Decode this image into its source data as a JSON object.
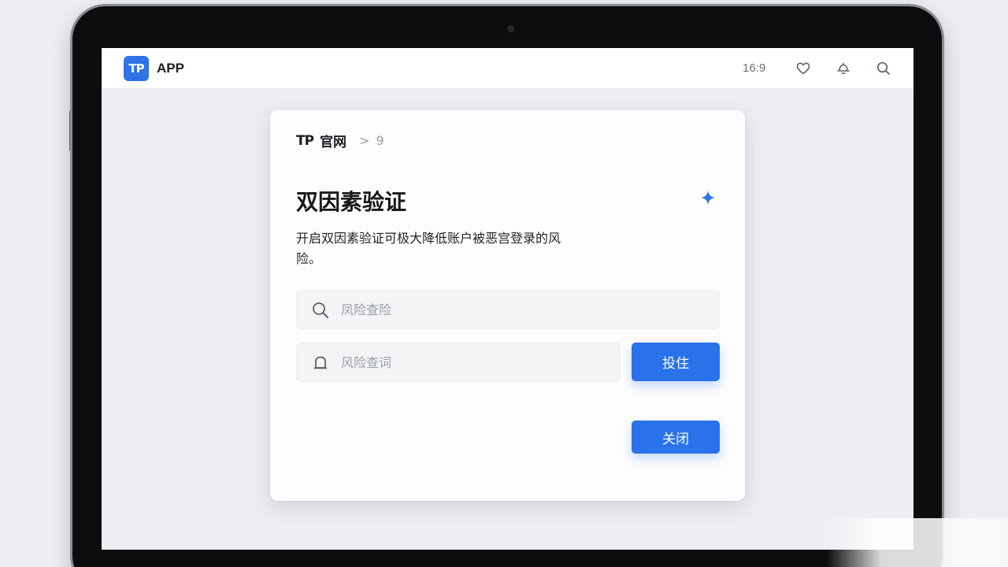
{
  "app": {
    "logo_text": "TP",
    "name": "APP"
  },
  "topbar": {
    "ratio_text": "16:9",
    "icons": [
      "heart-icon",
      "bell-icon",
      "search-icon"
    ]
  },
  "breadcrumb": {
    "logo_text": "TP",
    "site": "官网",
    "separator": ">",
    "page": "9"
  },
  "dialog": {
    "title": "双因素验证",
    "description": "开启双因素验证可极大降低账户被恶宫登录的风险。",
    "field_1": {
      "icon": "search-icon",
      "placeholder": "凤险查险",
      "value": ""
    },
    "field_2": {
      "icon": "bell-icon",
      "placeholder": "风险查词",
      "value": ""
    },
    "send_button_label": "投住",
    "close_button_label": "关闭"
  },
  "colors": {
    "accent": "#2a72ea",
    "logo_bg": "#2f74e6",
    "bezel": "#0d0d0f",
    "background": "#eceef2"
  }
}
